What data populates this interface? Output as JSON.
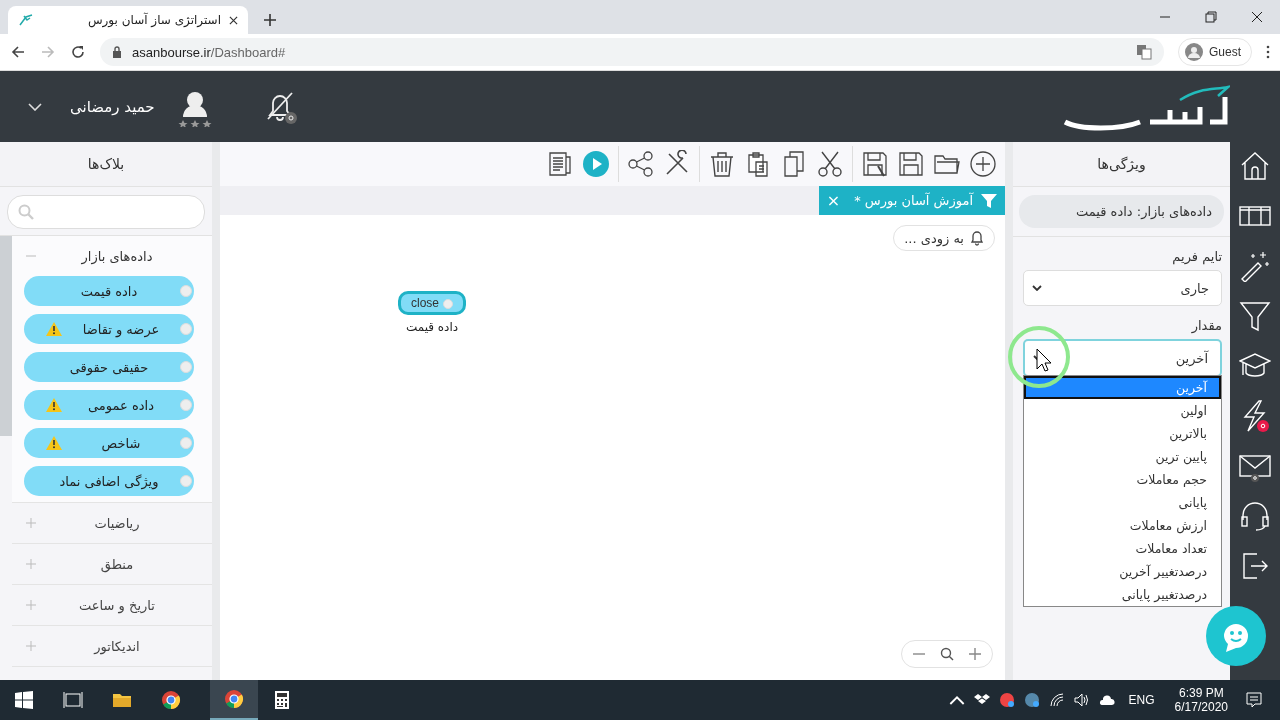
{
  "browser": {
    "tab_title": "استراتژی ساز آسان بورس",
    "url_host": "asanbourse.ir",
    "url_path": "/Dashboard#",
    "profile": "Guest"
  },
  "header": {
    "user_name": "حمید رمضانی"
  },
  "blocks_panel": {
    "title": "بلاک‌ها",
    "categories": [
      {
        "label": "داده‌های بازار",
        "expanded": true,
        "blocks": [
          {
            "label": "داده قیمت",
            "warning": false
          },
          {
            "label": "عرضه و تقاضا",
            "warning": true
          },
          {
            "label": "حقیقی حقوقی",
            "warning": false
          },
          {
            "label": "داده عمومی",
            "warning": true
          },
          {
            "label": "شاخص",
            "warning": true
          },
          {
            "label": "ویژگی اضافی نماد",
            "warning": false
          }
        ]
      },
      {
        "label": "ریاضیات",
        "expanded": false
      },
      {
        "label": "منطق",
        "expanded": false
      },
      {
        "label": "تاریخ و ساعت",
        "expanded": false
      },
      {
        "label": "اندیکاتور",
        "expanded": false
      }
    ]
  },
  "editor": {
    "tab": {
      "label": "آموزش آسان بورس *",
      "close": "×"
    },
    "notice": "به زودی ...",
    "node": {
      "chip": "close",
      "label": "داده قیمت"
    }
  },
  "properties": {
    "title": "ویژگی‌ها",
    "block_name": "داده‌های بازار: داده قیمت",
    "fields": [
      {
        "label": "تایم فریم",
        "value": "جاری",
        "open": false
      },
      {
        "label": "مقدار",
        "value": "آخرین",
        "open": true
      }
    ],
    "options": [
      {
        "label": "آخرین",
        "selected": true
      },
      {
        "label": "اولین",
        "selected": false
      },
      {
        "label": "بالاترین",
        "selected": false
      },
      {
        "label": "پایین ترین",
        "selected": false
      },
      {
        "label": "حجم معاملات",
        "selected": false
      },
      {
        "label": "پایانی",
        "selected": false
      },
      {
        "label": "ارزش معاملات",
        "selected": false
      },
      {
        "label": "تعداد معاملات",
        "selected": false
      },
      {
        "label": "درصدتغییر آخرین",
        "selected": false
      },
      {
        "label": "درصدتغییر پایانی",
        "selected": false
      }
    ]
  },
  "taskbar": {
    "language": "ENG",
    "time": "6:39 PM",
    "date": "6/17/2020"
  }
}
